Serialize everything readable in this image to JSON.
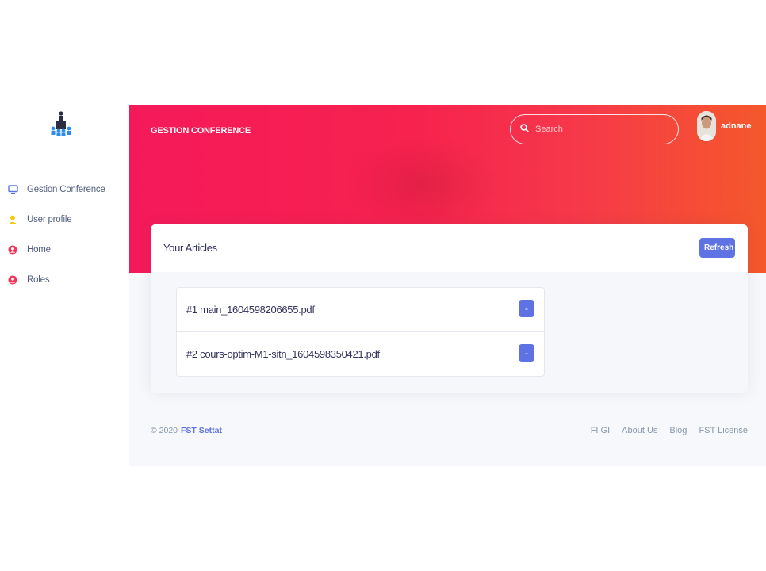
{
  "colors": {
    "accent": "#5e72e4",
    "header_start": "#f5195a",
    "header_end": "#f5582b"
  },
  "sidebar": {
    "logo_icon": "conference-podium-icon",
    "items": [
      {
        "label": "Gestion Conference",
        "icon": "monitor-icon",
        "color": "#5e72e4"
      },
      {
        "label": "User profile",
        "icon": "user-icon",
        "color": "#f6c90e"
      },
      {
        "label": "Home",
        "icon": "user-circle-icon",
        "color": "#f5365c"
      },
      {
        "label": "Roles",
        "icon": "user-circle-icon",
        "color": "#f5365c"
      }
    ]
  },
  "header": {
    "brand": "GESTION CONFERENCE",
    "search_placeholder": "Search",
    "username": "adnane"
  },
  "card": {
    "title": "Your Articles",
    "refresh_label": "Refresh",
    "items": [
      {
        "label": "#1 main_1604598206655.pdf",
        "button": "-"
      },
      {
        "label": "#2 cours-optim-M1-sitn_1604598350421.pdf",
        "button": "-"
      }
    ]
  },
  "footer": {
    "copyright": "© 2020",
    "org_link": "FST Settat",
    "links": [
      "FI GI",
      "About Us",
      "Blog",
      "FST License"
    ]
  }
}
